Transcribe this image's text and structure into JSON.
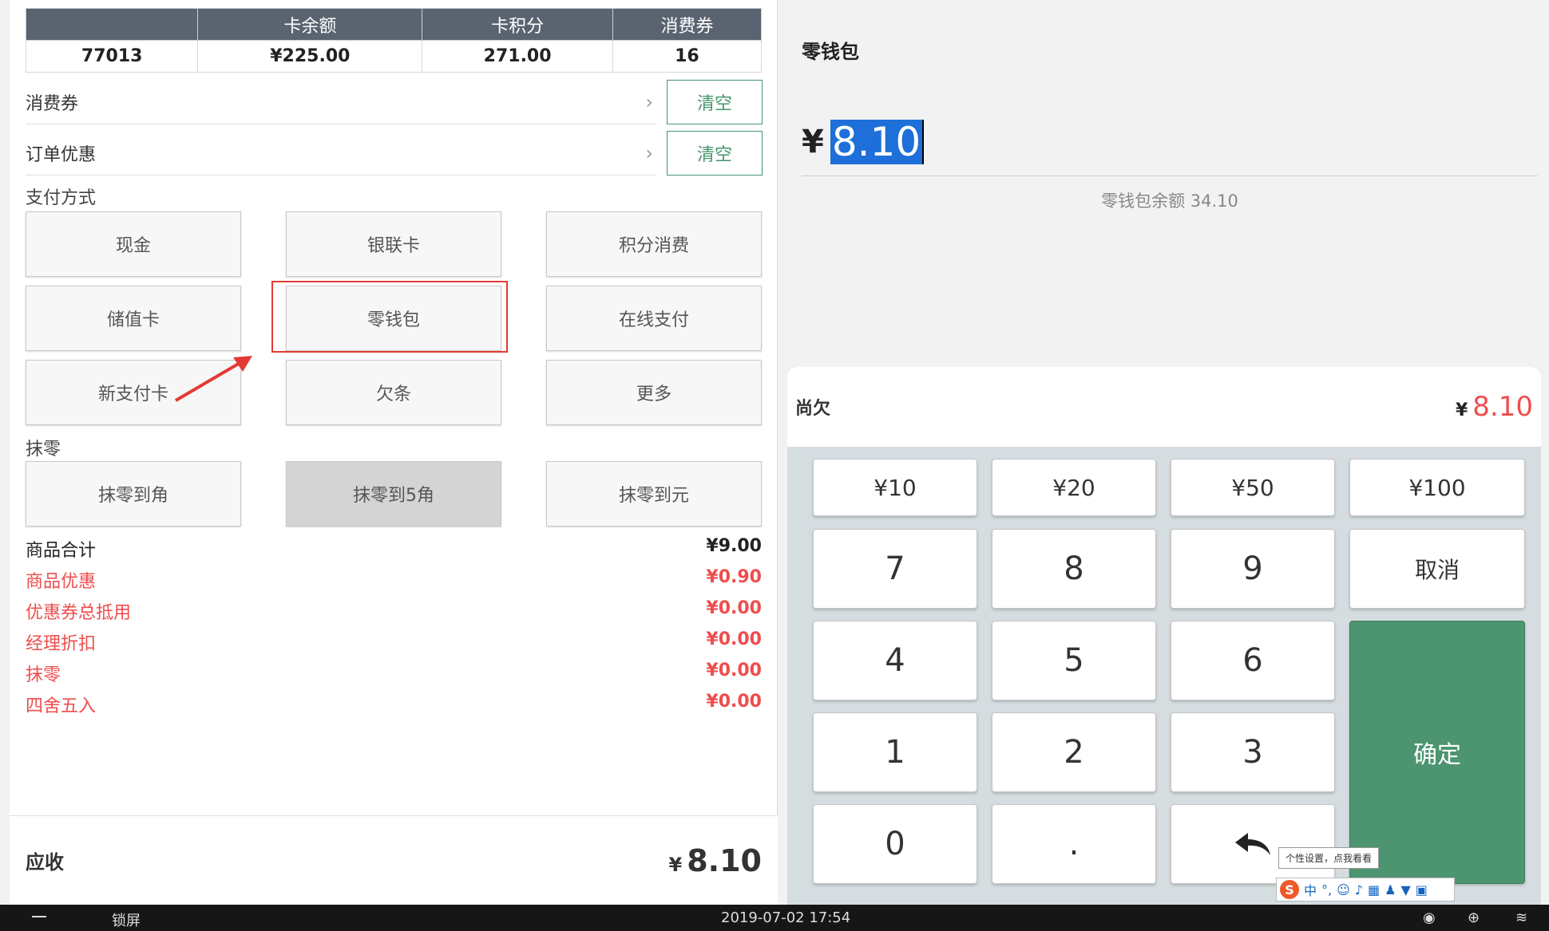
{
  "card_info": {
    "headers": [
      "",
      "卡余额",
      "卡积分",
      "消费券"
    ],
    "values": [
      "77013",
      "¥225.00",
      "271.00",
      "16"
    ]
  },
  "rows": {
    "voucher_label": "消费券",
    "order_discount_label": "订单优惠",
    "clear_label": "清空"
  },
  "payment": {
    "section_label": "支付方式",
    "methods": [
      "现金",
      "银联卡",
      "积分消费",
      "储值卡",
      "零钱包",
      "在线支付",
      "新支付卡",
      "欠条",
      "更多"
    ]
  },
  "rounding": {
    "section_label": "抹零",
    "options": [
      "抹零到角",
      "抹零到5角",
      "抹零到元"
    ]
  },
  "summary": [
    {
      "label": "商品合计",
      "value": "¥9.00"
    },
    {
      "label": "商品优惠",
      "value": "¥0.90"
    },
    {
      "label": "优惠券总抵用",
      "value": "¥0.00"
    },
    {
      "label": "经理折扣",
      "value": "¥0.00"
    },
    {
      "label": "抹零",
      "value": "¥0.00"
    },
    {
      "label": "四舍五入",
      "value": "¥0.00"
    }
  ],
  "footer": {
    "label": "应收",
    "currency": "¥",
    "amount": "8.10"
  },
  "wallet": {
    "title": "零钱包",
    "currency": "¥",
    "amount": "8.10",
    "balance_text": "零钱包余额 34.10"
  },
  "owe": {
    "label": "尚欠",
    "currency": "¥",
    "amount": "8.10"
  },
  "keypad": {
    "quick": [
      "¥10",
      "¥20",
      "¥50",
      "¥100"
    ],
    "digits": [
      "7",
      "8",
      "9",
      "4",
      "5",
      "6",
      "1",
      "2",
      "3",
      "0",
      "."
    ],
    "cancel": "取消",
    "confirm": "确定"
  },
  "ime": {
    "tooltip": "个性设置，点我看看",
    "lang": "中"
  },
  "taskbar": {
    "left_label": "锁屏",
    "datetime": "2019-07-02 17:54"
  },
  "colors": {
    "accent_green": "#43956b",
    "confirm_green": "#4d9470",
    "red": "#ef4d4d",
    "header_gray": "#5a6470",
    "highlight_red": "#e53935"
  }
}
